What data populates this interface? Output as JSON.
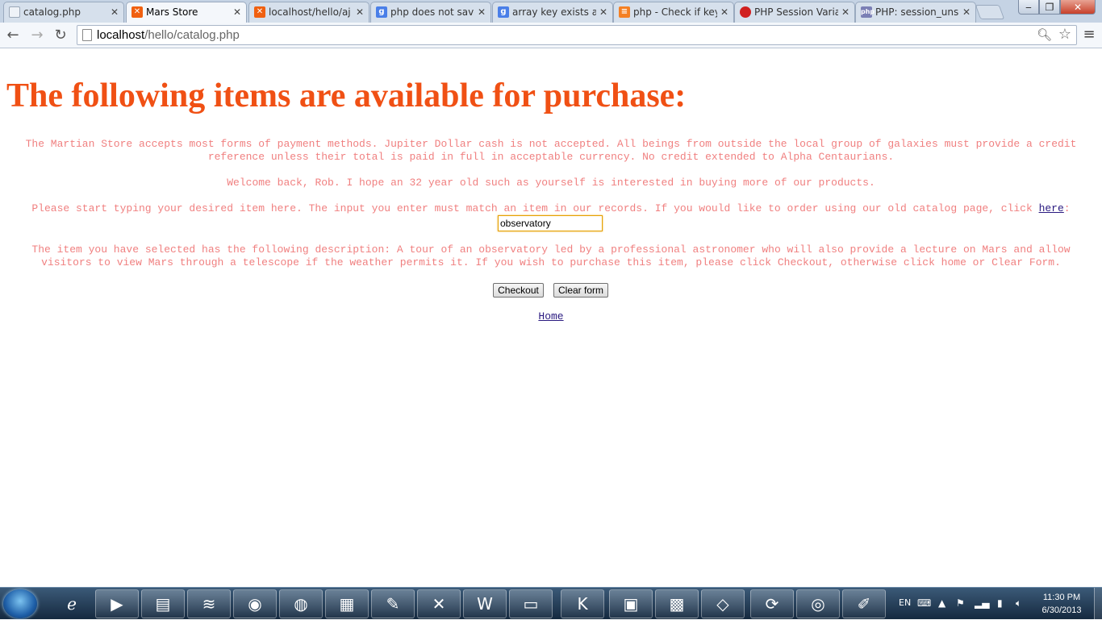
{
  "browser": {
    "tabs": [
      {
        "label": "catalog.php",
        "favicon": "page-icon",
        "color": "#9aa7b8"
      },
      {
        "label": "Mars Store",
        "favicon": "xampp-icon",
        "color": "#f06010",
        "active": true
      },
      {
        "label": "localhost/hello/aj",
        "favicon": "xampp-icon",
        "color": "#f06010"
      },
      {
        "label": "php does not save",
        "favicon": "google-icon",
        "color": "#4a7fe8"
      },
      {
        "label": "array key exists an",
        "favicon": "google-icon",
        "color": "#4a7fe8"
      },
      {
        "label": "php - Check if key",
        "favicon": "stackoverflow-icon",
        "color": "#f48024"
      },
      {
        "label": "PHP Session Varia",
        "favicon": "red-dot-icon",
        "color": "#d02020"
      },
      {
        "label": "PHP: session_unse",
        "favicon": "php-icon",
        "color": "#7b7fb5"
      }
    ],
    "url_host": "localhost",
    "url_path": "/hello/catalog.php"
  },
  "page": {
    "title": "The following items are available for purchase:",
    "payment_text": "The Martian Store accepts most forms of payment methods. Jupiter Dollar cash is not accepted. All beings from outside the local group of galaxies must provide a credit reference unless their total is paid in full in acceptable currency. No credit extended to Alpha Centaurians.",
    "welcome_text": "Welcome back, Rob. I hope an 32 year old such as yourself is interested in buying more of our products.",
    "typing_text": "Please start typing your desired item here. The input you enter must match an item in our records. If you would like to order using our old catalog page, click ",
    "here_link": "here",
    "typing_suffix": ":",
    "item_input_value": "observatory",
    "description_text": "The item you have selected has the following description: A tour of an observatory led by a professional astronomer who will also provide a lecture on Mars and allow visitors to view Mars through a telescope if the weather permits it. If you wish to purchase this item, please click Checkout, otherwise click home or Clear Form.",
    "checkout_label": "Checkout",
    "clear_label": "Clear form",
    "home_link": "Home"
  },
  "colors": {
    "title": "#f05014",
    "body_text": "#f08080",
    "link": "#2a1a80"
  },
  "taskbar": {
    "apps": [
      "media-player-icon",
      "explorer-icon",
      "wimax-icon",
      "firefox-icon",
      "chrome-icon",
      "calculator-icon",
      "paint-icon",
      "xampp-icon",
      "word-icon",
      "network-icon",
      "kaspersky-icon",
      "monitor-icon",
      "control-panel-icon",
      "notes-icon",
      "sync-icon",
      "connection-icon",
      "notepadpp-icon"
    ],
    "language": "EN",
    "time": "11:30 PM",
    "date": "6/30/2013"
  }
}
